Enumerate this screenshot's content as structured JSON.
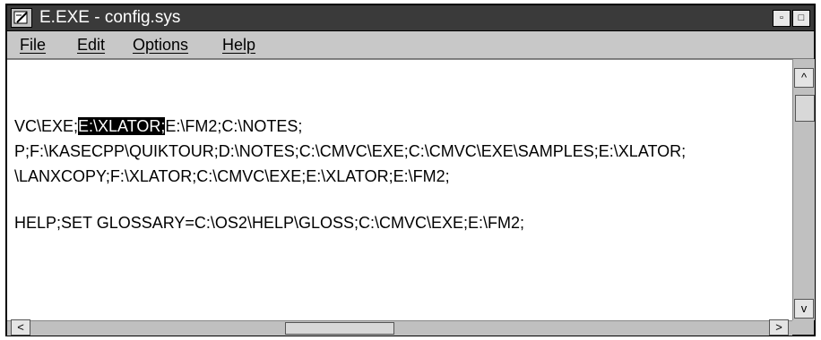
{
  "window": {
    "title": "E.EXE - config.sys",
    "min_glyph": "▫",
    "max_glyph": "□"
  },
  "menubar": {
    "items": [
      "File",
      "Edit",
      "Options",
      "Help"
    ]
  },
  "editor": {
    "lines": [
      {
        "pre": "VC\\EXE;",
        "selected": "E:\\XLATOR;",
        "post": "E:\\FM2;C:\\NOTES;"
      },
      {
        "pre": "P;F:\\KASECPP\\QUIKTOUR;D:\\NOTES;C:\\CMVC\\EXE;C:\\CMVC\\EXE\\SAMPLES;E:\\XLATOR;",
        "selected": "",
        "post": ""
      },
      {
        "pre": "\\LANXCOPY;F:\\XLATOR;C:\\CMVC\\EXE;E:\\XLATOR;E:\\FM2;",
        "selected": "",
        "post": ""
      },
      {
        "pre": "HELP;SET GLOSSARY=C:\\OS2\\HELP\\GLOSS;C:\\CMVC\\EXE;E:\\FM2;",
        "selected": "",
        "post": ""
      }
    ]
  },
  "scrollbars": {
    "up": "^",
    "down": "v",
    "left": "<",
    "right": ">"
  },
  "colors": {
    "titlebar": "#3a3a3a",
    "chrome": "#c0c0c0",
    "selection": "#000000"
  }
}
